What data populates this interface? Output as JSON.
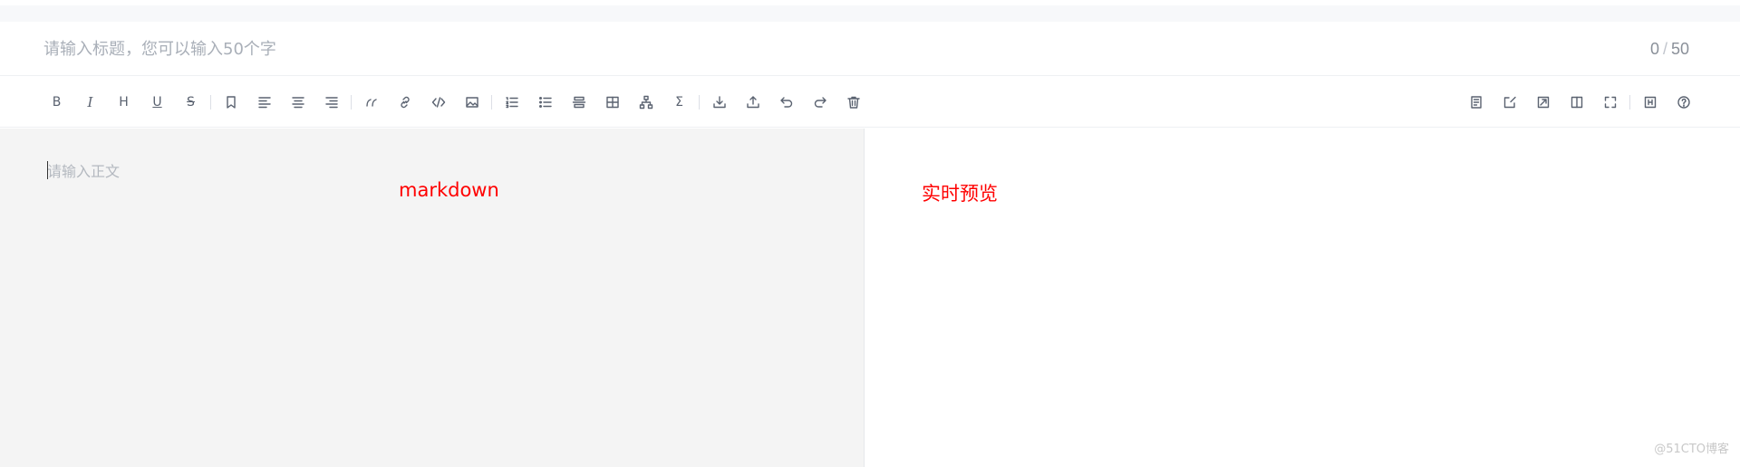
{
  "title_bar": {
    "placeholder": "请输入标题，您可以输入50个字",
    "count_current": "0",
    "count_separator": "/",
    "count_max": "50"
  },
  "toolbar": {
    "left_icons": [
      "bold-icon",
      "italic-icon",
      "heading-icon",
      "underline-icon",
      "strikethrough-icon",
      "bookmark-icon",
      "align-left-icon",
      "align-center-icon",
      "align-right-icon",
      "quote-icon",
      "link-icon",
      "code-icon",
      "image-icon",
      "ordered-list-icon",
      "unordered-list-icon",
      "divider-icon",
      "table-icon",
      "diagram-icon",
      "formula-icon",
      "download-icon",
      "upload-icon",
      "undo-icon",
      "redo-icon",
      "trash-icon"
    ],
    "right_icons": [
      "edit-only-icon",
      "edit-toggle-icon",
      "preview-only-icon",
      "split-view-icon",
      "fullscreen-icon",
      "heading-nav-icon",
      "help-icon"
    ],
    "bold_label": "B",
    "italic_label": "I",
    "heading_label": "H",
    "underline_label": "U",
    "strike_label": "S",
    "sigma_label": "Σ"
  },
  "editor": {
    "placeholder": "请输入正文",
    "annotation": "markdown",
    "background": "#f4f4f4"
  },
  "preview": {
    "annotation": "实时预览"
  },
  "watermark": "@51CTO博客",
  "colors": {
    "annotation": "#ff0000",
    "icon": "#5a6270",
    "placeholder": "#a9afb8"
  }
}
